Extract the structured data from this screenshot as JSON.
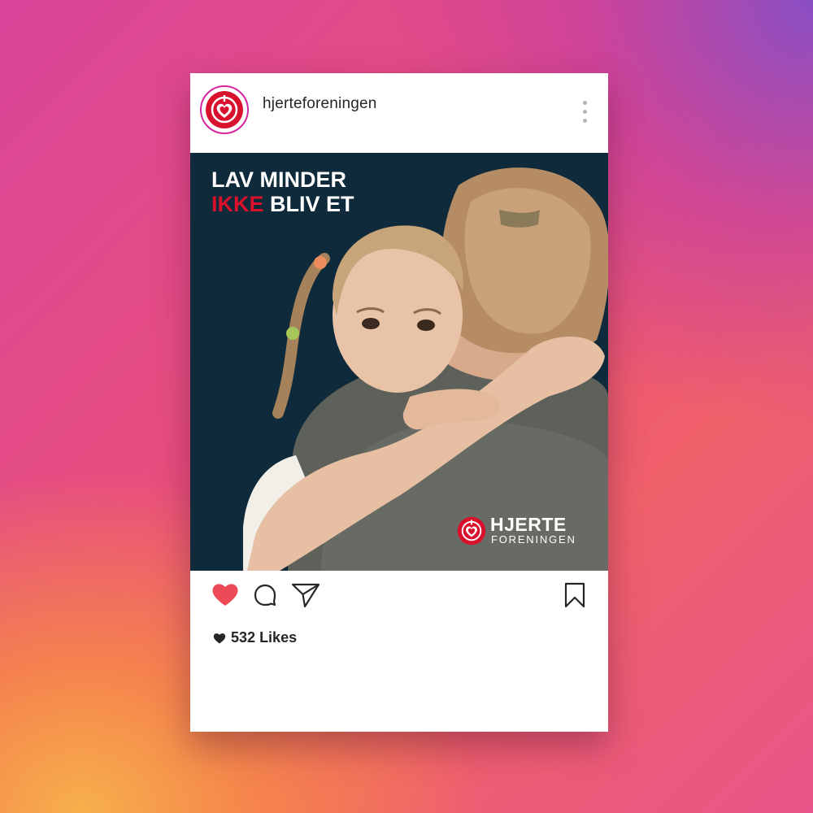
{
  "post": {
    "username": "hjerteforeningen",
    "avatar_icon": "heart-logo-icon",
    "headline_line1": "LAV MINDER",
    "headline_highlight": "IKKE",
    "headline_line2_rest": " BLIV ET",
    "brand_name_top": "HJERTE",
    "brand_name_bottom": "FORENINGEN",
    "likes_count": "532",
    "likes_label": "Likes"
  },
  "actions": {
    "like_icon": "heart-filled-icon",
    "comment_icon": "comment-icon",
    "share_icon": "send-icon",
    "save_icon": "bookmark-icon",
    "more_icon": "more-vertical-icon"
  },
  "colors": {
    "brand_red": "#d8112c",
    "like_red": "#ed4956",
    "post_background": "#0f2a3a"
  }
}
